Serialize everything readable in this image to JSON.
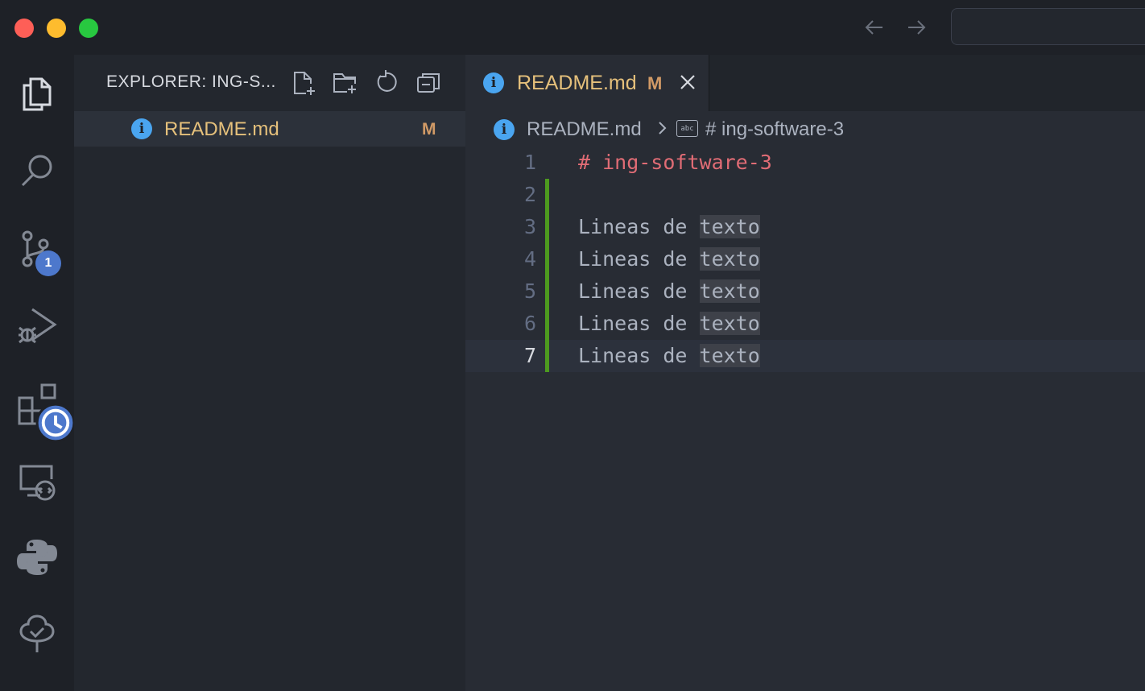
{
  "window": {
    "title_bar": {
      "back_icon": "arrow-left-icon",
      "forward_icon": "arrow-right-icon"
    }
  },
  "activity_bar": {
    "items": [
      {
        "name": "explorer",
        "icon": "files-icon"
      },
      {
        "name": "search",
        "icon": "search-icon"
      },
      {
        "name": "source-control",
        "icon": "source-control-icon",
        "badge": "1"
      },
      {
        "name": "run-and-debug",
        "icon": "run-debug-icon"
      },
      {
        "name": "extensions",
        "icon": "extensions-icon"
      },
      {
        "name": "remote-explorer",
        "icon": "remote-explorer-icon"
      },
      {
        "name": "python",
        "icon": "python-icon"
      },
      {
        "name": "tree",
        "icon": "tree-icon"
      }
    ]
  },
  "sidebar": {
    "title": "EXPLORER: ING-S...",
    "actions": [
      "new-file-icon",
      "new-folder-icon",
      "refresh-icon",
      "collapse-all-icon"
    ],
    "files": [
      {
        "name": "README.md",
        "status": "M"
      }
    ]
  },
  "editor": {
    "tab": {
      "title": "README.md",
      "status": "M"
    },
    "breadcrumb": {
      "file": "README.md",
      "symbol_icon": "abc",
      "heading": "# ing-software-3"
    },
    "lines": [
      {
        "number": "1",
        "text": "# ing-software-3"
      },
      {
        "number": "2",
        "text": ""
      },
      {
        "number": "3",
        "prefix": "Lineas de ",
        "highlight": "texto"
      },
      {
        "number": "4",
        "prefix": "Lineas de ",
        "highlight": "texto"
      },
      {
        "number": "5",
        "prefix": "Lineas de ",
        "highlight": "texto"
      },
      {
        "number": "6",
        "prefix": "Lineas de ",
        "highlight": "texto"
      },
      {
        "number": "7",
        "prefix": "Lineas de ",
        "highlight": "texto"
      }
    ]
  },
  "colors": {
    "accent": "#4d78cc",
    "modified": "#e5c07b",
    "heading": "#e06c75",
    "gutter_added": "#4d9a1f"
  }
}
